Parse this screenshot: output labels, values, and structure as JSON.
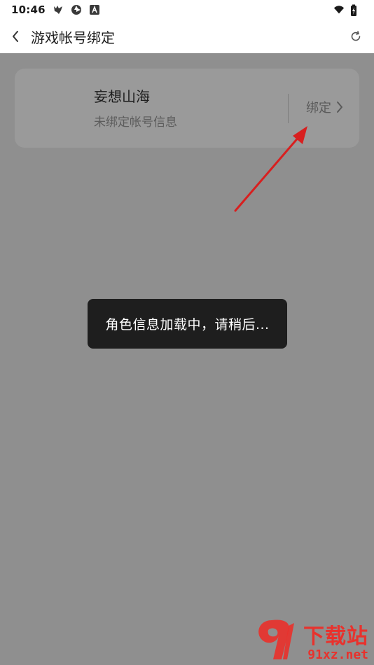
{
  "status_bar": {
    "time": "10:46",
    "left_icons": [
      "wolf-app-icon",
      "aperture-icon",
      "text-a-icon"
    ],
    "right_icons": [
      "wifi-icon",
      "battery-charging-icon"
    ]
  },
  "header": {
    "title": "游戏帐号绑定",
    "back_icon": "chevron-left-icon",
    "refresh_icon": "refresh-icon"
  },
  "game_card": {
    "name": "妄想山海",
    "status": "未绑定帐号信息",
    "bind_label": "绑定"
  },
  "toast": {
    "message": "角色信息加载中，请稍后..."
  },
  "watermark": {
    "site_name": "下载站",
    "url": "91xz.net"
  },
  "colors": {
    "overlay_background": "#8f8f8f",
    "card_background": "#9a9a9a",
    "toast_background": "#1e1e1e",
    "annotation_arrow": "#e02424",
    "watermark": "#e8322d"
  }
}
